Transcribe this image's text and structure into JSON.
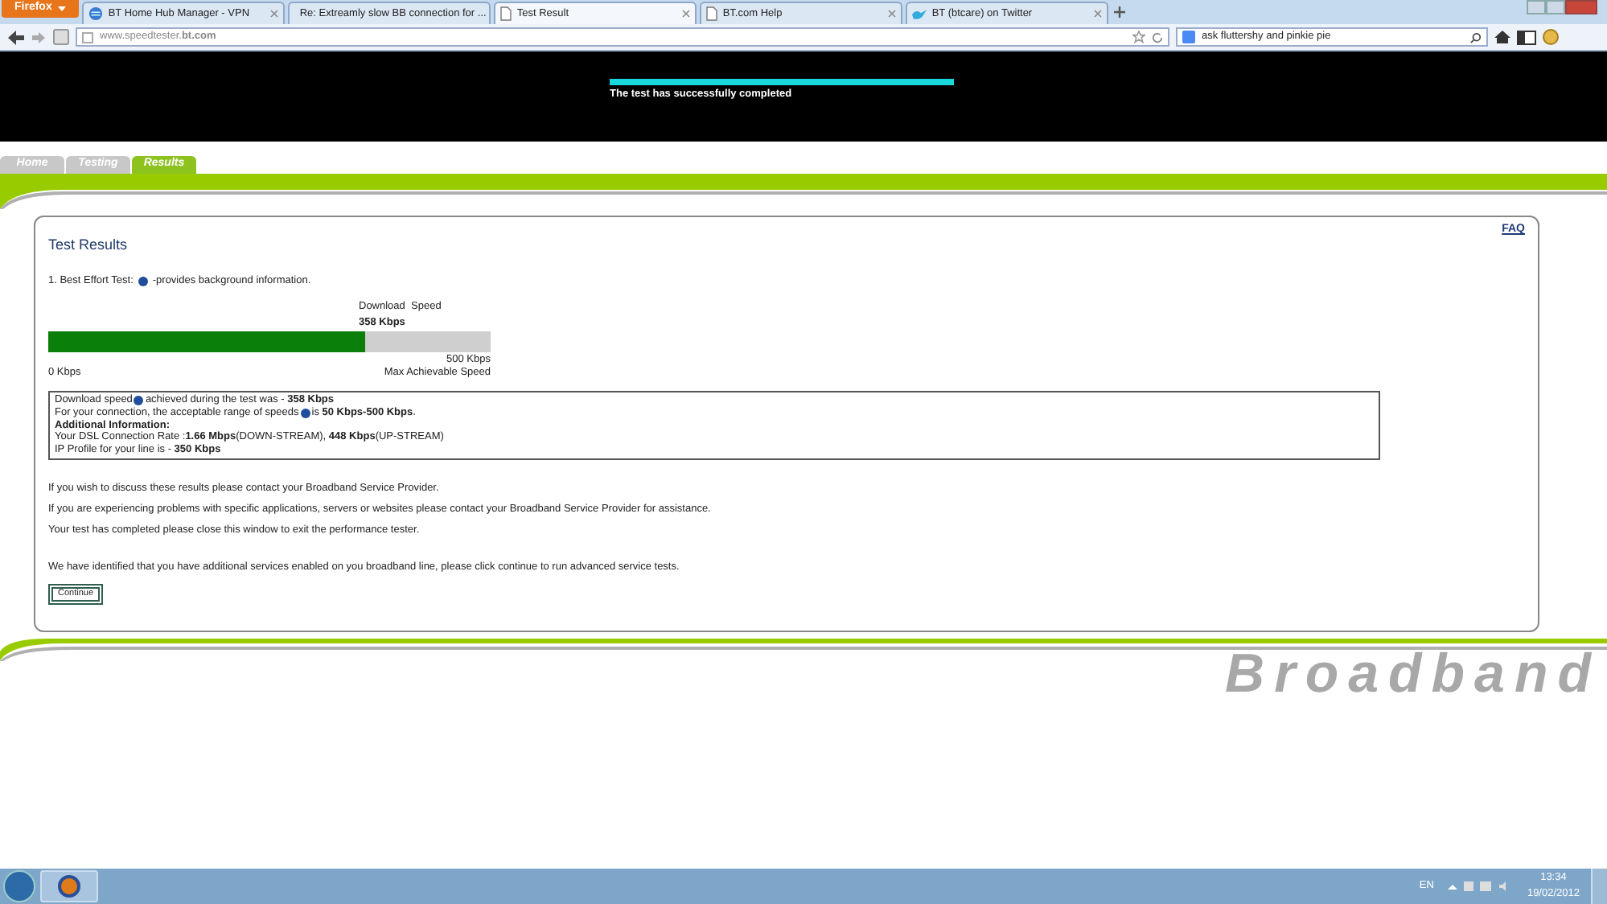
{
  "browser": {
    "menu_button": "Firefox",
    "tabs": [
      {
        "title": "BT Home Hub Manager - VPN",
        "selected": false
      },
      {
        "title": "Re: Extreamly slow BB connection for ...",
        "selected": false
      },
      {
        "title": "Test Result",
        "selected": true
      },
      {
        "title": "BT.com Help",
        "selected": false
      },
      {
        "title": "BT (btcare) on Twitter",
        "selected": false
      }
    ],
    "url": "www.speedtester.**bt.com**",
    "search": "ask fluttershy and pinkie pie"
  },
  "header": {
    "status": "The test has successfully completed"
  },
  "site_tabs": [
    {
      "label": "Home",
      "selected": false
    },
    {
      "label": "Testing",
      "selected": false
    },
    {
      "label": "Results",
      "selected": true
    }
  ],
  "results": {
    "faq": "FAQ",
    "title": "Test Results",
    "intro": [
      "1. Best Effort Test:",
      "-provides background information."
    ],
    "meter": {
      "label": "Download  Speed",
      "value": "358 Kbps",
      "level": 0.716,
      "min": "0 Kbps",
      "max": "500 Kbps",
      "max_caption": "Max Achievable Speed"
    },
    "info_lines": [
      [
        {
          "kind": "text",
          "text": "Download speed"
        },
        {
          "kind": "info"
        },
        {
          "kind": "text",
          "text": "achieved during the test was - **358 Kbps**"
        }
      ],
      [
        {
          "kind": "text",
          "text": "For your connection, the acceptable range of speeds"
        },
        {
          "kind": "info"
        },
        {
          "kind": "text",
          "text": "is **50 Kbps-500 Kbps**."
        }
      ],
      [
        {
          "kind": "text",
          "text": "**Additional Information:**"
        }
      ],
      [
        {
          "kind": "text",
          "text": "Your DSL Connection Rate :**1.66 Mbps**(DOWN-STREAM), **448 Kbps**(UP-STREAM)"
        }
      ],
      [
        {
          "kind": "text",
          "text": "IP Profile for your line is - **350 Kbps**"
        }
      ]
    ],
    "paragraphs": [
      "If you wish to discuss these results please contact your Broadband Service Provider.",
      "If you are experiencing problems with specific applications, servers or websites please contact your Broadband Service Provider for assistance.",
      "Your test has completed please close this window to exit the performance tester."
    ],
    "notice": "We have identified that you have additional services enabled on you broadband line, please click continue to run advanced service tests.",
    "continue_button": "Continue"
  },
  "brand": "Broadband",
  "taskbar": {
    "language": "EN",
    "time": "13:34",
    "date": "19/02/2012"
  }
}
